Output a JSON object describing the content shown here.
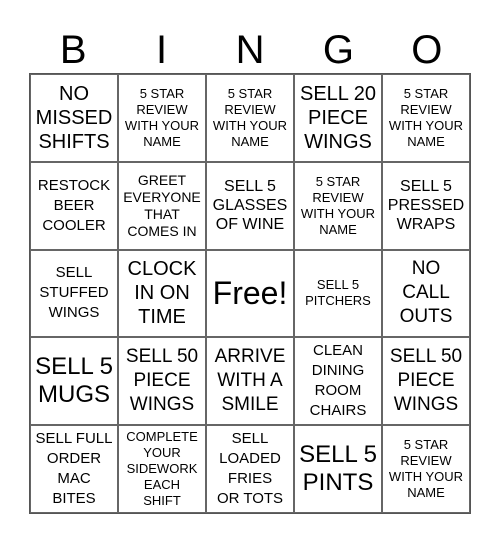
{
  "header": [
    "B",
    "I",
    "N",
    "G",
    "O"
  ],
  "cells": [
    [
      "NO\nMISSED\nSHIFTS",
      "5 STAR\nREVIEW\nWITH YOUR\nNAME",
      "5 STAR\nREVIEW\nWITH YOUR\nNAME",
      "SELL 20\nPIECE\nWINGS",
      "5 STAR\nREVIEW\nWITH YOUR\nNAME"
    ],
    [
      "RESTOCK\nBEER\nCOOLER",
      "GREET\nEVERYONE\nTHAT\nCOMES IN",
      "SELL 5\nGLASSES\nOF WINE",
      "5 STAR\nREVIEW\nWITH YOUR\nNAME",
      "SELL 5\nPRESSED\nWRAPS"
    ],
    [
      "SELL\nSTUFFED\nWINGS",
      "CLOCK\nIN ON\nTIME",
      "Free!",
      "SELL 5\nPITCHERS",
      "NO\nCALL\nOUTS"
    ],
    [
      "SELL 5\nMUGS",
      "SELL 50\nPIECE\nWINGS",
      "ARRIVE\nWITH A\nSMILE",
      "CLEAN\nDINING\nROOM\nCHAIRS",
      "SELL 50\nPIECE\nWINGS"
    ],
    [
      "SELL FULL\nORDER\nMAC\nBITES",
      "COMPLETE\nYOUR\nSIDEWORK\nEACH\nSHIFT",
      "SELL\nLOADED\nFRIES\nOR TOTS",
      "SELL 5\nPINTS",
      "5 STAR\nREVIEW\nWITH YOUR\nNAME"
    ]
  ]
}
